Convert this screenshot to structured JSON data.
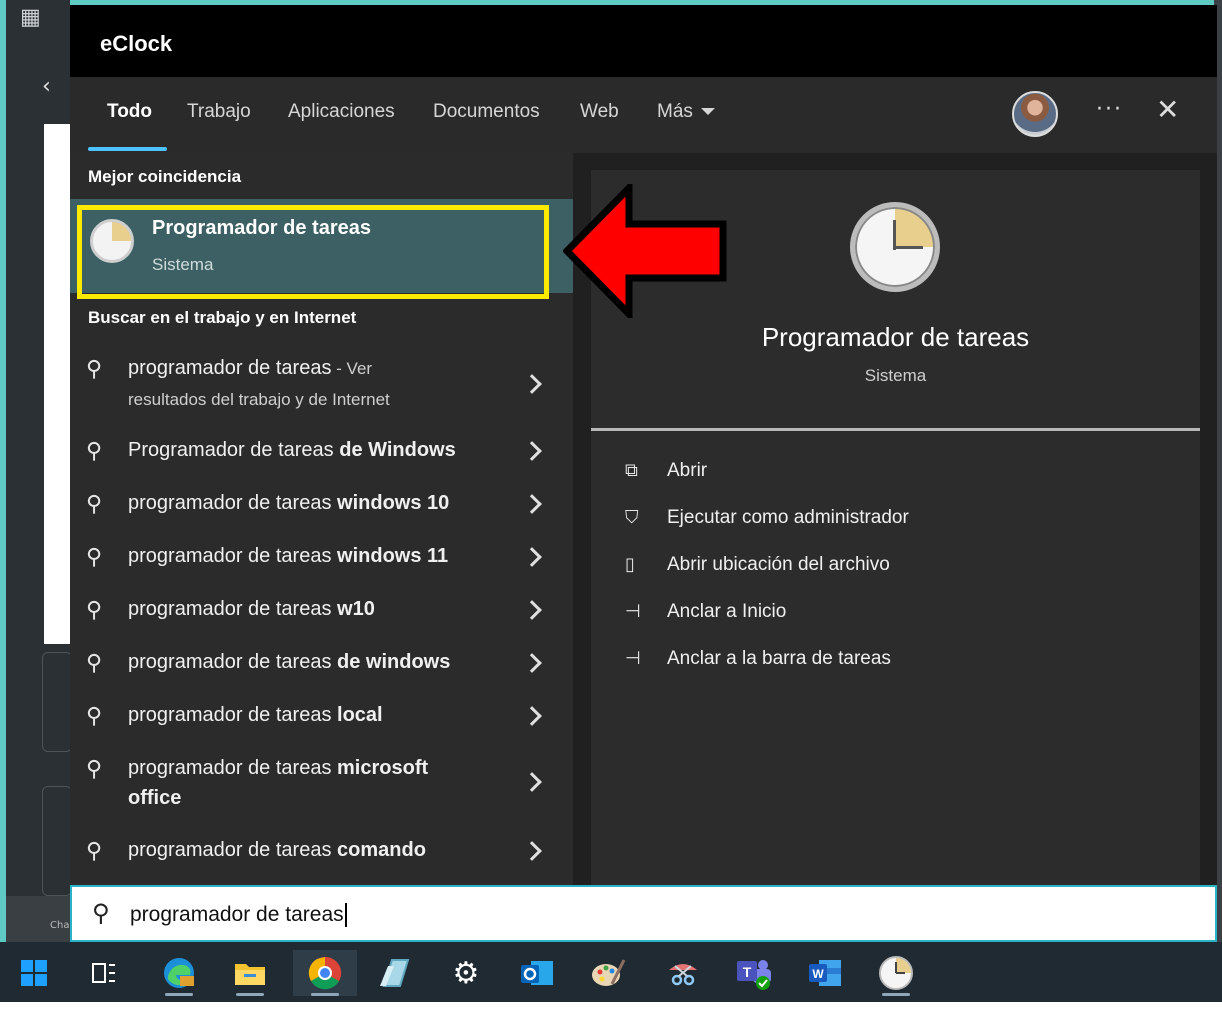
{
  "window": {
    "title": "eClock"
  },
  "tabs": [
    {
      "label": "Todo"
    },
    {
      "label": "Trabajo"
    },
    {
      "label": "Aplicaciones"
    },
    {
      "label": "Documentos"
    },
    {
      "label": "Web"
    },
    {
      "label": "Más"
    }
  ],
  "header": {
    "more_label": "···",
    "close_label": "✕"
  },
  "best_match": {
    "heading": "Mejor coincidencia",
    "title": "Programador de tareas",
    "subtitle": "Sistema"
  },
  "web_section": {
    "heading": "Buscar en el trabajo y en Internet"
  },
  "suggestions": [
    {
      "prefix": "programador de tareas",
      "bold": "",
      "sub": " - Ver",
      "sub2": "resultados del trabajo y de Internet"
    },
    {
      "prefix": "Programador de tareas ",
      "bold": "de Windows",
      "sub": "",
      "sub2": ""
    },
    {
      "prefix": "programador de tareas ",
      "bold": "windows 10",
      "sub": "",
      "sub2": ""
    },
    {
      "prefix": "programador de tareas ",
      "bold": "windows 11",
      "sub": "",
      "sub2": ""
    },
    {
      "prefix": "programador de tareas ",
      "bold": "w10",
      "sub": "",
      "sub2": ""
    },
    {
      "prefix": "programador de tareas ",
      "bold": "de windows",
      "sub": "",
      "sub2": ""
    },
    {
      "prefix": "programador de tareas ",
      "bold": "local",
      "sub": "",
      "sub2": ""
    },
    {
      "prefix": "programador de tareas ",
      "bold": "microsoft",
      "sub": "",
      "sub2": "office"
    },
    {
      "prefix": "programador de tareas ",
      "bold": "comando",
      "sub": "",
      "sub2": ""
    }
  ],
  "detail": {
    "title": "Programador de tareas",
    "subtitle": "Sistema",
    "actions": [
      {
        "label": "Abrir",
        "icon": "open-icon"
      },
      {
        "label": "Ejecutar como administrador",
        "icon": "shield-icon"
      },
      {
        "label": "Abrir ubicación del archivo",
        "icon": "folder-icon"
      },
      {
        "label": "Anclar a Inicio",
        "icon": "pin-icon"
      },
      {
        "label": "Anclar a la barra de tareas",
        "icon": "pin-icon"
      }
    ]
  },
  "search": {
    "value": "programador de tareas"
  },
  "background": {
    "chat_label": "Cha"
  },
  "colors": {
    "accent": "#4cc2ff",
    "highlight_box": "#ffea00",
    "arrow": "#ff0000",
    "selected_row": "#3c6063"
  }
}
